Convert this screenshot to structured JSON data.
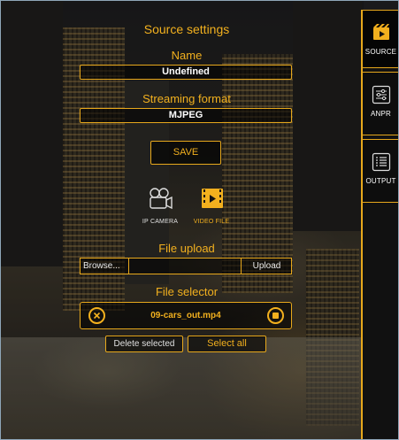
{
  "panel": {
    "title": "Source settings",
    "name_label": "Name",
    "name_value": "Undefined",
    "format_label": "Streaming format",
    "format_value": "MJPEG",
    "save_label": "SAVE"
  },
  "sources": [
    {
      "label": "IP CAMERA",
      "icon": "ip-camera-icon",
      "selected": false
    },
    {
      "label": "VIDEO FILE",
      "icon": "video-file-icon",
      "selected": true
    }
  ],
  "upload": {
    "label": "File upload",
    "browse_label": "Browse...",
    "upload_label": "Upload"
  },
  "selector": {
    "label": "File selector",
    "file": "09-cars_out.mp4",
    "delete_label": "Delete selected",
    "select_all_label": "Select all"
  },
  "tabs": [
    {
      "label": "SOURCE",
      "icon": "film-icon",
      "active": true
    },
    {
      "label": "ANPR",
      "icon": "sliders-icon",
      "active": false
    },
    {
      "label": "OUTPUT",
      "icon": "list-icon",
      "active": false
    }
  ],
  "colors": {
    "accent": "#f2b01e",
    "border": "#e7a81c",
    "text": "#ffffff"
  }
}
